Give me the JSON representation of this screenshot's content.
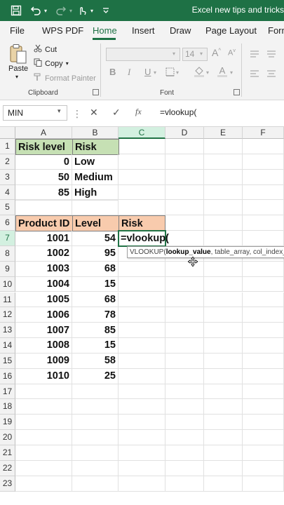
{
  "titlebar": {
    "title": "Excel new tips and tricks",
    "bg_color": "#1e7145"
  },
  "tabs": [
    "File",
    "WPS PDF",
    "Home",
    "Insert",
    "Draw",
    "Page Layout",
    "Form"
  ],
  "active_tab": "Home",
  "ribbon": {
    "clipboard": {
      "paste": "Paste",
      "cut": "Cut",
      "copy": "Copy",
      "format_painter": "Format Painter",
      "group_label": "Clipboard"
    },
    "font": {
      "size": "14",
      "group_label": "Font",
      "bold": "B",
      "italic": "I",
      "underline": "U"
    }
  },
  "formula_bar": {
    "name_box": "MIN",
    "fx_label": "fx",
    "formula": "=vlookup("
  },
  "columns": [
    "A",
    "B",
    "C",
    "D",
    "E",
    "F"
  ],
  "rows": [
    "1",
    "2",
    "3",
    "4",
    "5",
    "6",
    "7",
    "8",
    "9",
    "10",
    "11",
    "12",
    "13",
    "14",
    "15",
    "16",
    "17",
    "18",
    "19",
    "20",
    "21",
    "22",
    "23"
  ],
  "sheet": {
    "lookup_header": [
      "Risk level",
      "Risk"
    ],
    "lookup_rows": [
      [
        "0",
        "Low"
      ],
      [
        "50",
        "Medium"
      ],
      [
        "85",
        "High"
      ]
    ],
    "data_header": [
      "Product ID",
      "Level",
      "Risk"
    ],
    "data_rows": [
      [
        "1001",
        "54"
      ],
      [
        "1002",
        "95"
      ],
      [
        "1003",
        "68"
      ],
      [
        "1004",
        "15"
      ],
      [
        "1005",
        "68"
      ],
      [
        "1006",
        "78"
      ],
      [
        "1007",
        "85"
      ],
      [
        "1008",
        "15"
      ],
      [
        "1009",
        "58"
      ],
      [
        "1010",
        "25"
      ]
    ],
    "active_cell_text": "=vlookup(",
    "green_fill": "#c6e0b4",
    "orange_fill": "#f8cbad"
  },
  "tooltip": {
    "func": "VLOOKUP(",
    "arg1": "lookup_value",
    "rest": ", table_array, col_index_"
  }
}
